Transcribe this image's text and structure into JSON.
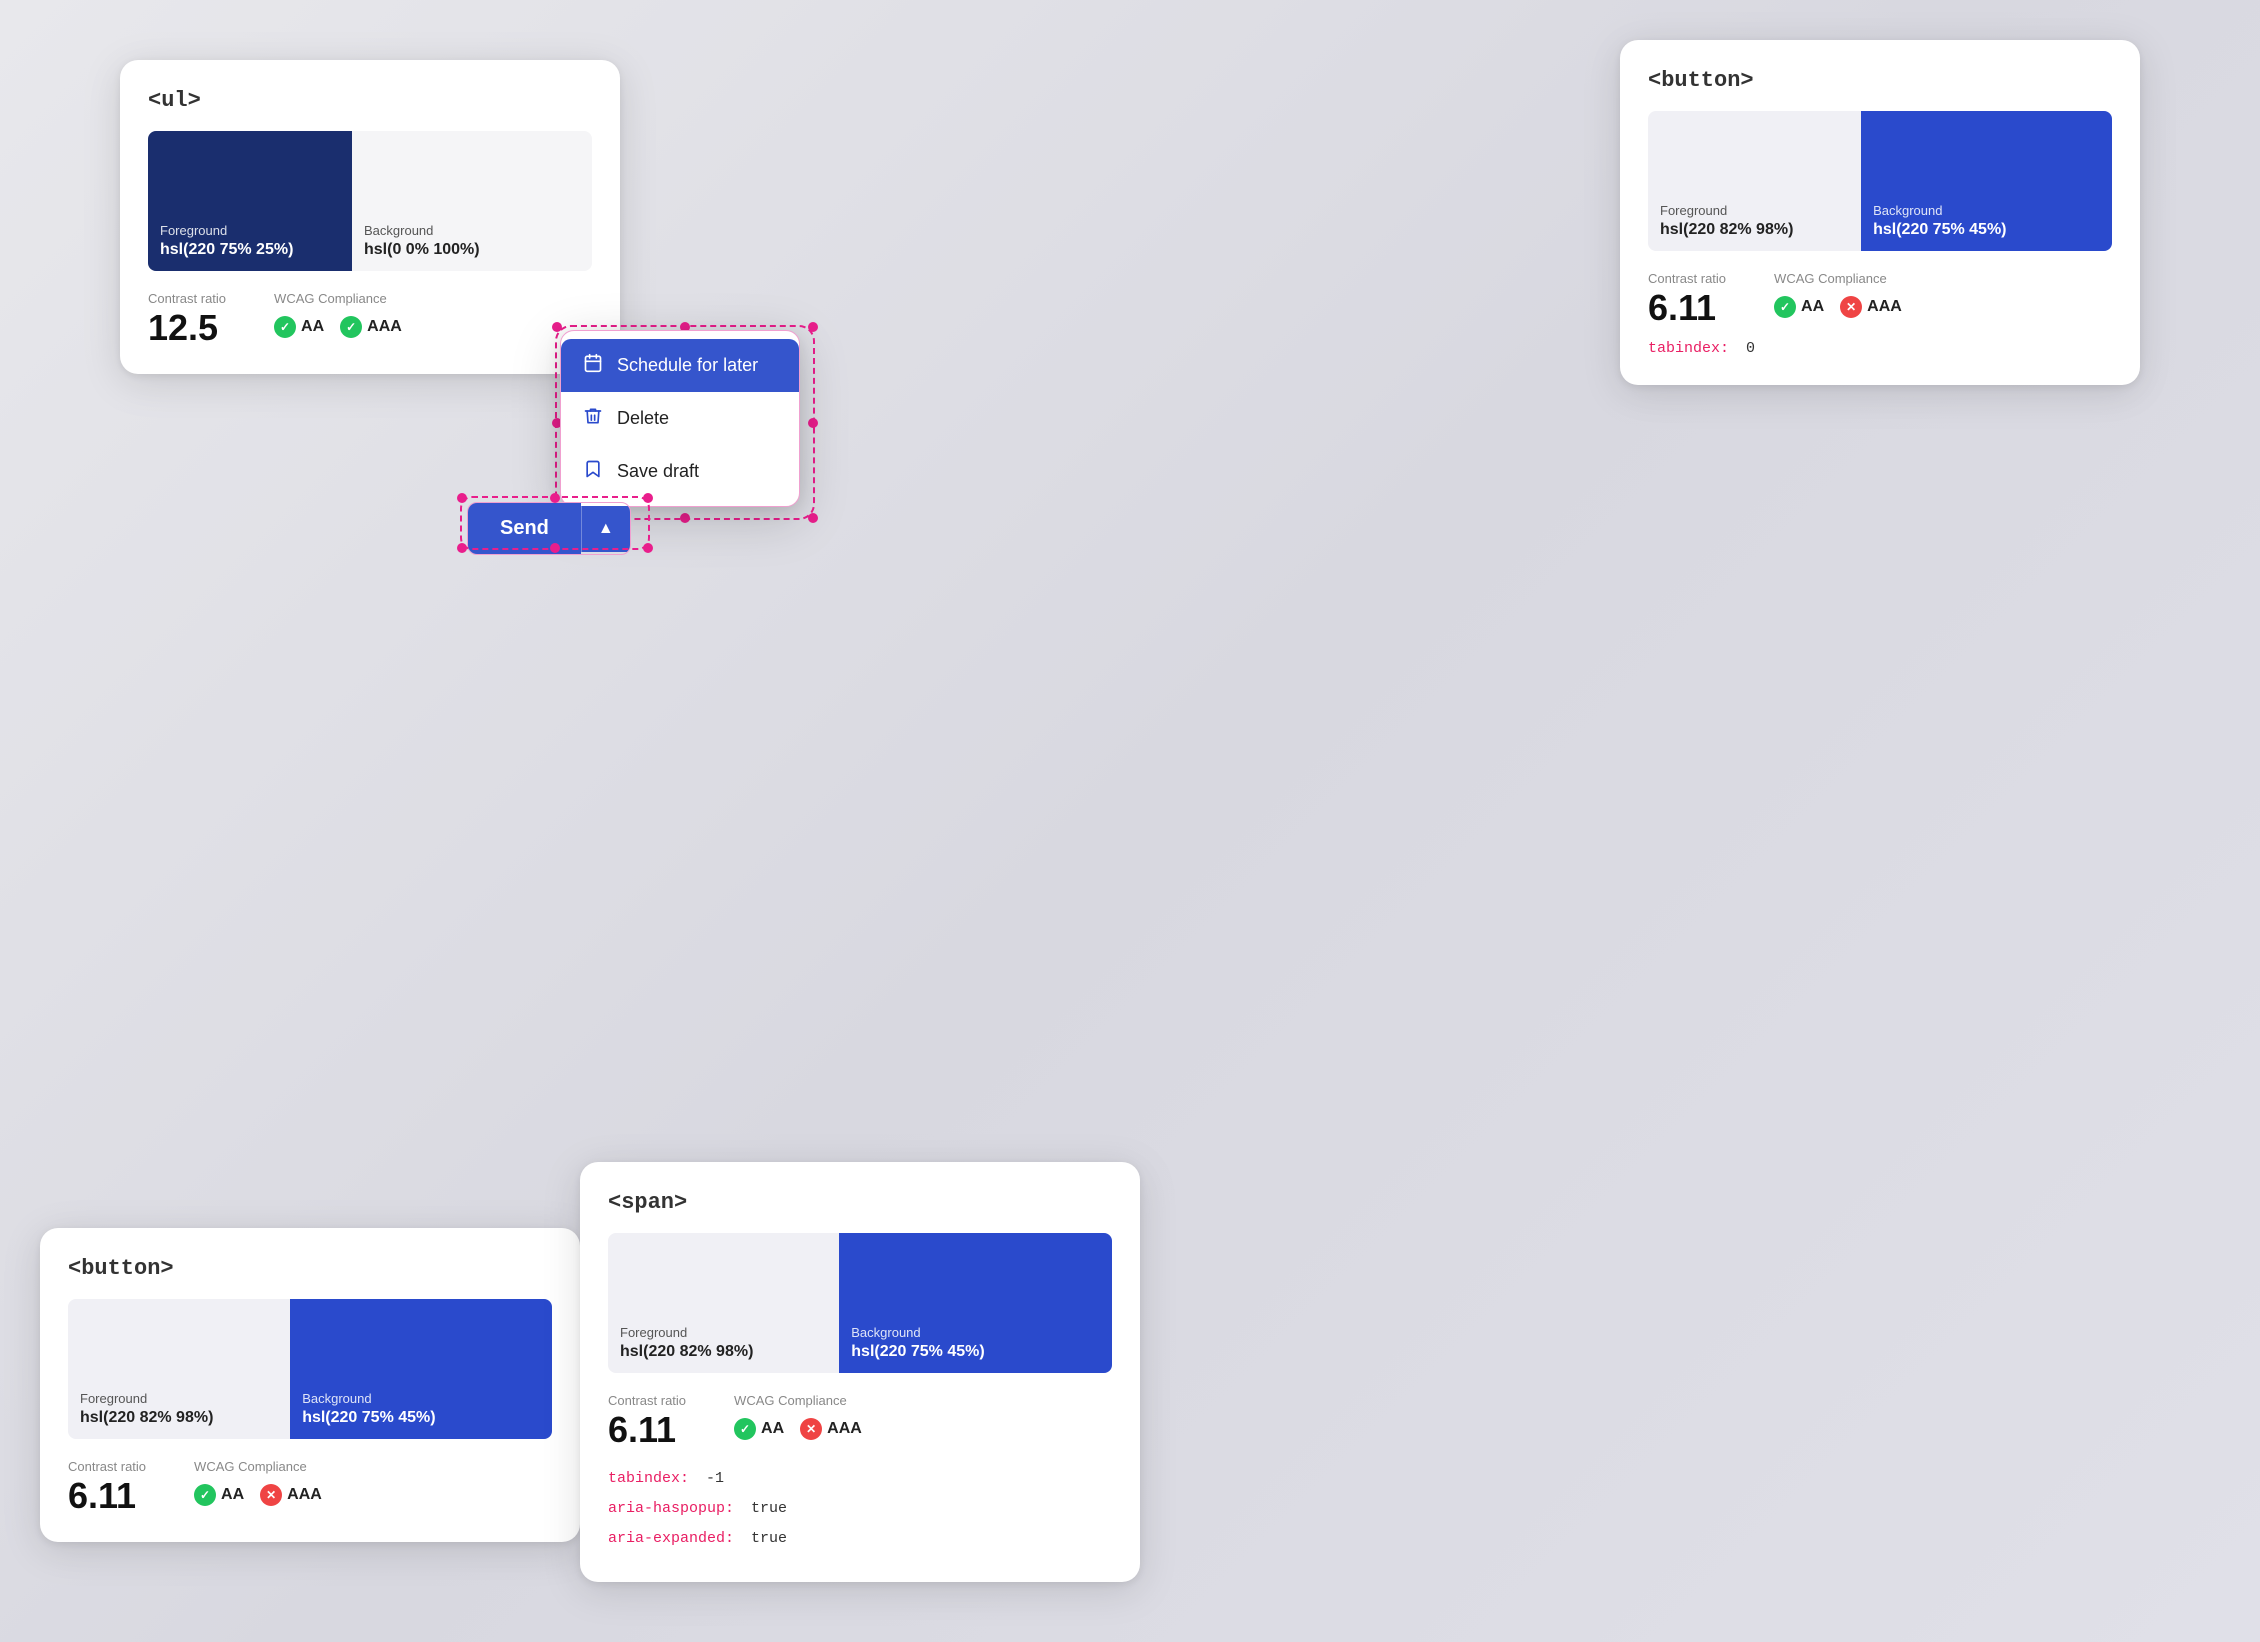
{
  "cards": {
    "ul": {
      "title": "<ul>",
      "swatch1": {
        "label": "Foreground",
        "value": "hsl(220 75% 25%)",
        "bg": "#1a2e6e"
      },
      "swatch2": {
        "label": "Background",
        "value": "hsl(0 0% 100%)",
        "bg": "#f0f0f0"
      },
      "contrast_label": "Contrast ratio",
      "contrast_value": "12.5",
      "wcag_label": "WCAG Compliance",
      "aa_label": "AA",
      "aaa_label": "AAA"
    },
    "button_top": {
      "title": "<button>",
      "swatch1": {
        "label": "Foreground",
        "value": "hsl(220 82% 98%)",
        "bg": "#f0f0f0"
      },
      "swatch2": {
        "label": "Background",
        "value": "hsl(220 75% 45%)",
        "bg": "#2a4acc"
      },
      "contrast_label": "Contrast ratio",
      "contrast_value": "6.11",
      "wcag_label": "WCAG Compliance",
      "aa_label": "AA",
      "aaa_label": "AAA",
      "tabindex_label": "tabindex:",
      "tabindex_value": "0"
    },
    "button_bottom": {
      "title": "<button>",
      "swatch1": {
        "label": "Foreground",
        "value": "hsl(220 82% 98%)",
        "bg": "#f0f0f0"
      },
      "swatch2": {
        "label": "Background",
        "value": "hsl(220 75% 45%)",
        "bg": "#2a4acc"
      },
      "contrast_label": "Contrast ratio",
      "contrast_value": "6.11",
      "wcag_label": "WCAG Compliance",
      "aa_label": "AA",
      "aaa_label": "AAA"
    },
    "span": {
      "title": "<span>",
      "swatch1": {
        "label": "Foreground",
        "value": "hsl(220 82% 98%)",
        "bg": "#f0f0f0"
      },
      "swatch2": {
        "label": "Background",
        "value": "hsl(220 75% 45%)",
        "bg": "#2a4acc"
      },
      "contrast_label": "Contrast ratio",
      "contrast_value": "6.11",
      "wcag_label": "WCAG Compliance",
      "aa_label": "AA",
      "aaa_label": "AAA",
      "tabindex_label": "tabindex:",
      "tabindex_value": "-1",
      "aria_haspopup_label": "aria-haspopup:",
      "aria_haspopup_value": "true",
      "aria_expanded_label": "aria-expanded:",
      "aria_expanded_value": "true"
    }
  },
  "dropdown": {
    "items": [
      {
        "icon": "📅",
        "label": "Schedule for later"
      },
      {
        "icon": "🗑",
        "label": "Delete"
      },
      {
        "icon": "🔖",
        "label": "Save draft"
      }
    ]
  },
  "send_button": {
    "label": "Send",
    "chevron": "▲"
  }
}
